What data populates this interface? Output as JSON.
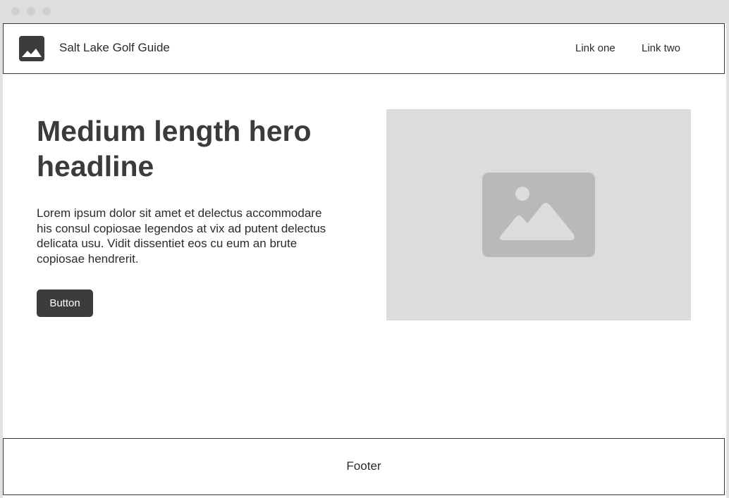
{
  "header": {
    "site_title": "Salt Lake Golf Guide",
    "logo_icon": "image-icon",
    "nav": [
      {
        "label": "Link one"
      },
      {
        "label": "Link two"
      }
    ]
  },
  "hero": {
    "headline": "Medium length hero headline",
    "body": "Lorem ipsum dolor sit amet et delectus accommodare his consul copiosae legendos at vix ad putent delectus delicata usu. Vidit dissentiet eos cu eum an brute copiosae hendrerit.",
    "button_label": "Button",
    "image_icon": "image-placeholder-icon"
  },
  "footer": {
    "label": "Footer"
  },
  "colors": {
    "dark": "#3c3c3c",
    "placeholder_bg": "#dcdcdc",
    "placeholder_icon": "#b9b9b9",
    "border": "#3a3a3a"
  }
}
